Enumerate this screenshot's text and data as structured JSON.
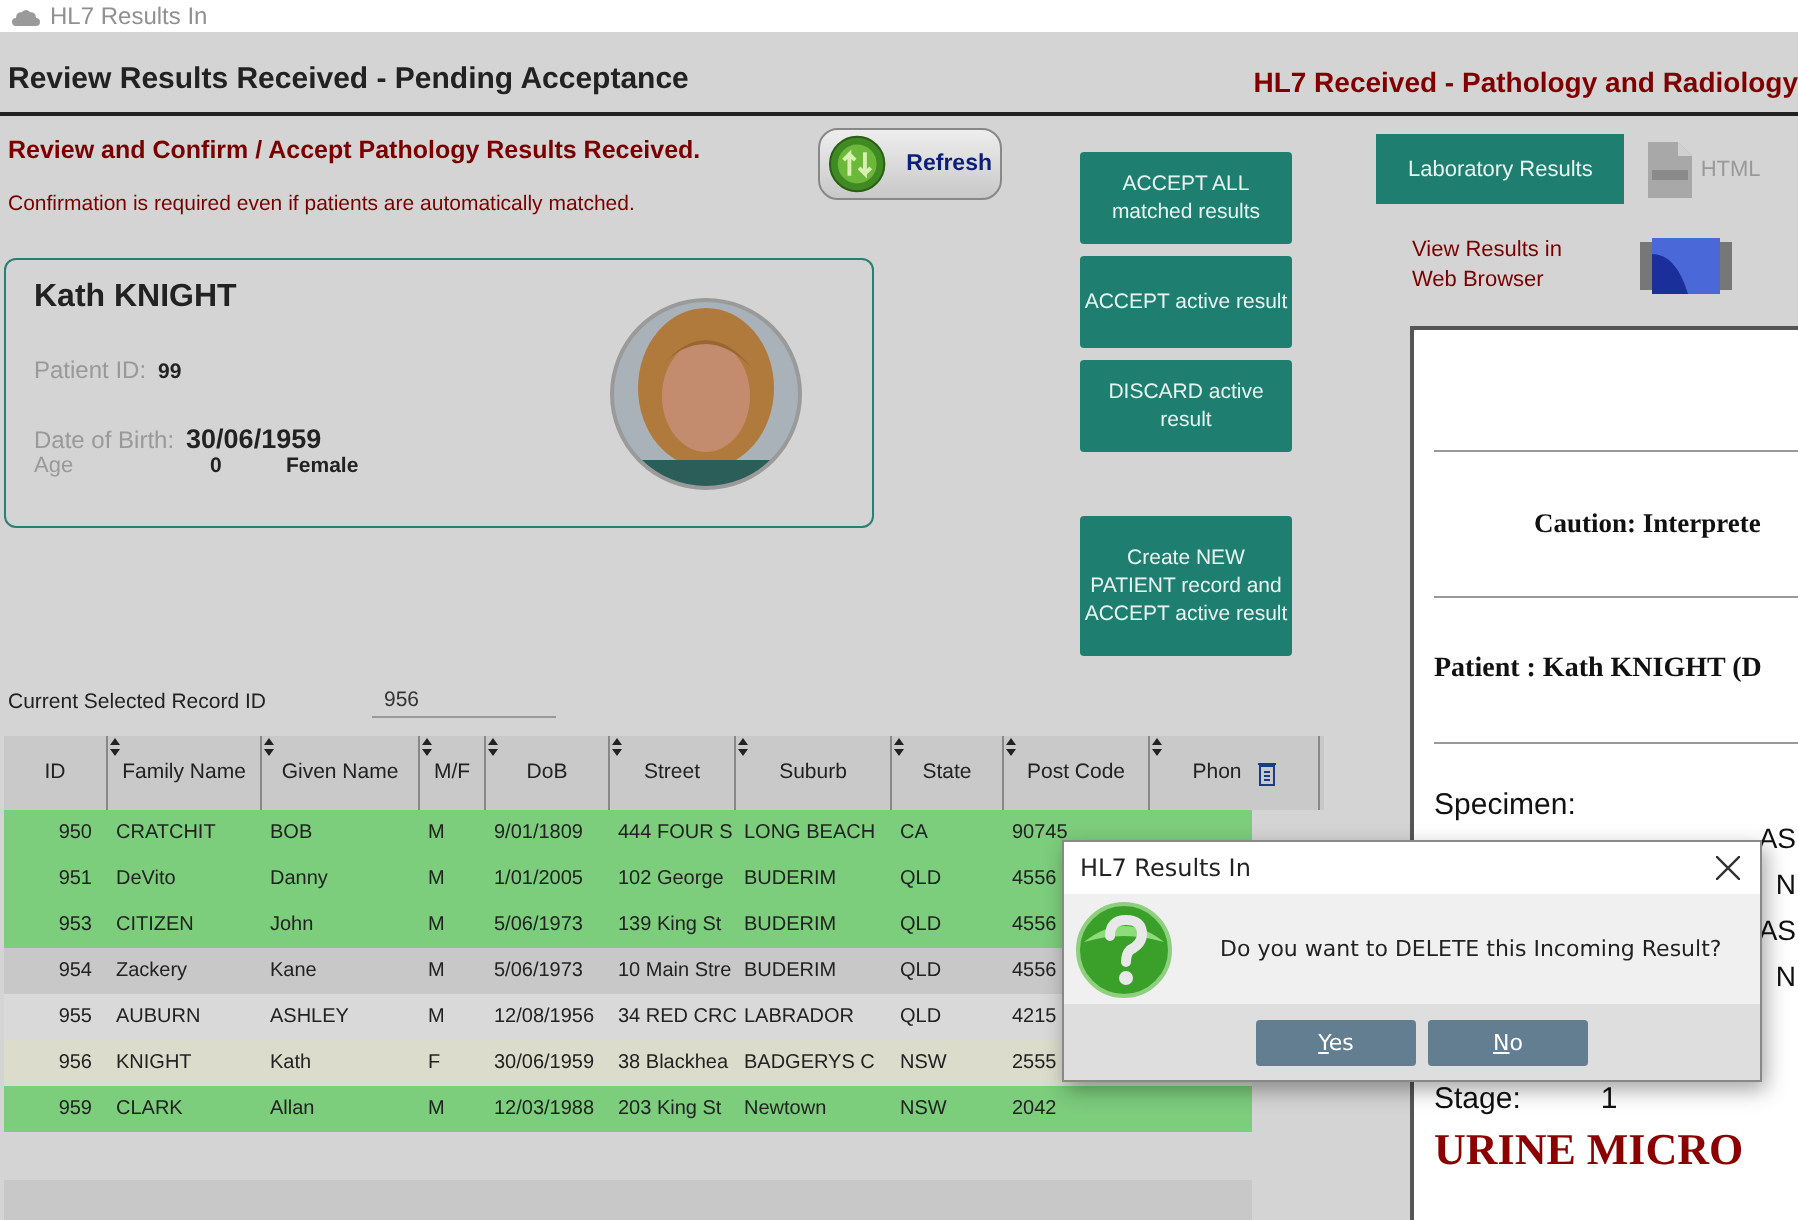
{
  "window": {
    "title": "HL7 Results In"
  },
  "header": {
    "title": "Review Results Received - Pending Acceptance",
    "module": "HL7 Received - Pathology and Radiology"
  },
  "instructions": {
    "heading": "Review and Confirm / Accept Pathology Results Received.",
    "note": "Confirmation is required even if patients are automatically matched."
  },
  "refresh_button": "Refresh",
  "patient": {
    "name": "Kath KNIGHT",
    "id_label": "Patient ID:",
    "id": "99",
    "dob_label": "Date of Birth:",
    "dob": "30/06/1959",
    "age_label": "Age",
    "age": "0",
    "sex": "Female"
  },
  "actions": [
    "ACCEPT ALL matched results",
    "ACCEPT active result",
    "DISCARD active result",
    "Create NEW PATIENT record and ACCEPT active result"
  ],
  "record": {
    "label": "Current Selected Record ID",
    "value": "956"
  },
  "table": {
    "columns": [
      "ID",
      "Family Name",
      "Given Name",
      "M/F",
      "DoB",
      "Street",
      "Suburb",
      "State",
      "Post Code",
      "Phon"
    ],
    "rows": [
      {
        "cells": [
          "950",
          "CRATCHIT",
          "BOB",
          "M",
          "9/01/1809",
          "444 FOUR S",
          "LONG BEACH",
          "CA",
          "90745"
        ],
        "matched": true,
        "selected": false
      },
      {
        "cells": [
          "951",
          "DeVito",
          "Danny",
          "M",
          "1/01/2005",
          "102 George",
          "BUDERIM",
          "QLD",
          "4556"
        ],
        "matched": true,
        "selected": false
      },
      {
        "cells": [
          "953",
          "CITIZEN",
          "John",
          "M",
          "5/06/1973",
          "139 King St",
          "BUDERIM",
          "QLD",
          "4556"
        ],
        "matched": true,
        "selected": false
      },
      {
        "cells": [
          "954",
          "Zackery",
          "Kane",
          "M",
          "5/06/1973",
          "10 Main Stre",
          "BUDERIM",
          "QLD",
          "4556"
        ],
        "matched": false,
        "selected": false
      },
      {
        "cells": [
          "955",
          "AUBURN",
          "ASHLEY",
          "M",
          "12/08/1956",
          "34 RED CRC",
          "LABRADOR",
          "QLD",
          "4215"
        ],
        "matched": false,
        "selected": false
      },
      {
        "cells": [
          "956",
          "KNIGHT",
          "Kath",
          "F",
          "30/06/1959",
          "38 Blackhea",
          "BADGERYS C",
          "NSW",
          "2555"
        ],
        "matched": false,
        "selected": true
      },
      {
        "cells": [
          "959",
          "CLARK",
          "Allan",
          "M",
          "12/03/1988",
          "203 King St",
          "Newtown",
          "NSW",
          "2042"
        ],
        "matched": true,
        "selected": false
      }
    ]
  },
  "viewer": {
    "tabs": [
      {
        "label": "Laboratory Results",
        "selected": true
      },
      {
        "label": "HTML",
        "selected": false
      }
    ],
    "browser_link": "View Results in Web Browser",
    "report": {
      "caution": "Caution: Interprete",
      "patient": "Patient : Kath KNIGHT (D",
      "specimen_label": "Specimen:",
      "fragments": [
        "AS",
        "N",
        "AS",
        "N"
      ],
      "stage_label": "Stage:",
      "stage": "1",
      "section": "URINE MICRO"
    }
  },
  "dialog": {
    "title": "HL7 Results In",
    "message": "Do you want to DELETE this Incoming Result?",
    "buttons": [
      "Yes",
      "No"
    ]
  }
}
